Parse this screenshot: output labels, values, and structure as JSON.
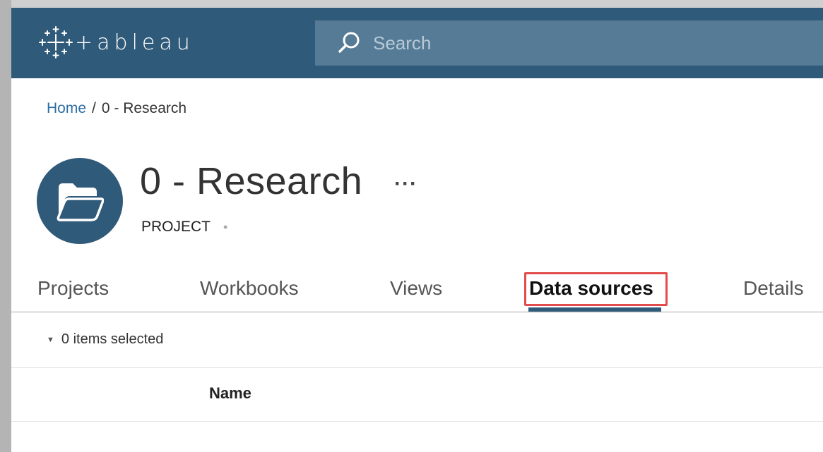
{
  "header": {
    "brand": "+ableau",
    "search_placeholder": "Search"
  },
  "breadcrumb": {
    "home": "Home",
    "separator": "/",
    "current": "0 - Research"
  },
  "project": {
    "title": "0 - Research",
    "more": "···",
    "type_label": "PROJECT",
    "type_dot": "•",
    "icon": "folder-open-icon"
  },
  "tabs": [
    {
      "label": "Projects",
      "active": false
    },
    {
      "label": "Workbooks",
      "active": false
    },
    {
      "label": "Views",
      "active": false
    },
    {
      "label": "Data sources",
      "active": true
    },
    {
      "label": "Details",
      "active": false
    }
  ],
  "selection": {
    "label": "0 items selected"
  },
  "table": {
    "columns": [
      "Name"
    ]
  },
  "colors": {
    "header_bg": "#2f5a7a",
    "search_bg": "#557b96",
    "highlight": "#e24c4c",
    "link": "#2d6ea3"
  }
}
